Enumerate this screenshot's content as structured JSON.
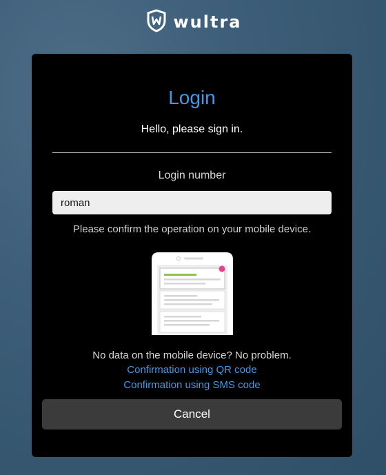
{
  "brand": {
    "name": "wultra"
  },
  "login": {
    "title": "Login",
    "subtitle": "Hello, please sign in.",
    "field_label": "Login number",
    "field_value": "roman",
    "confirm_message": "Please confirm the operation on your mobile device.",
    "no_data_text": "No data on the mobile device? No problem.",
    "qr_link": "Confirmation using QR code",
    "sms_link": "Confirmation using SMS code",
    "cancel_label": "Cancel"
  },
  "colors": {
    "background": "#3e5f7a",
    "card": "#000000",
    "accent": "#3f9be9",
    "notification_dot": "#e8418e",
    "phone_highlight": "#8cc63f"
  },
  "icons": {
    "logo": "wultra-shield-icon",
    "illustration": "phone-notification-illustration"
  }
}
